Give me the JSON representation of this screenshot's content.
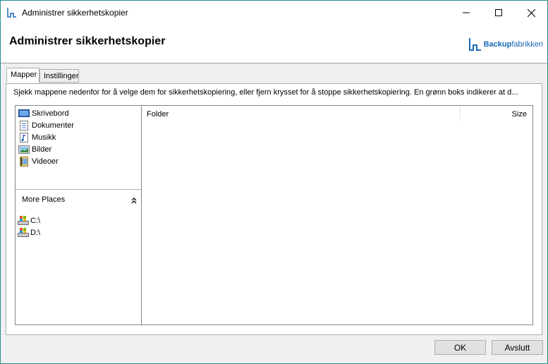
{
  "window": {
    "title": "Administrer sikkerhetskopier",
    "minimize_icon": "minimize-icon",
    "maximize_icon": "maximize-icon",
    "close_icon": "close-icon"
  },
  "header": {
    "heading": "Administrer sikkerhetskopier",
    "logo": {
      "bold": "Backup",
      "rest": "fabrikken",
      "color": "#1769b5"
    }
  },
  "tabs": [
    {
      "label": "Mapper",
      "active": true
    },
    {
      "label": "Instillinger",
      "active": false
    }
  ],
  "instruction": "Sjekk mappene nedenfor for å velge dem for sikkerhetskopiering, eller fjern krysset for å stoppe sikkerhetskopiering. En grønn boks indikerer at d...",
  "folders": [
    {
      "label": "Skrivebord",
      "icon": "desktop-icon"
    },
    {
      "label": "Dokumenter",
      "icon": "documents-icon"
    },
    {
      "label": "Musikk",
      "icon": "music-icon"
    },
    {
      "label": "Bilder",
      "icon": "pictures-icon"
    },
    {
      "label": "Videoer",
      "icon": "videos-icon"
    }
  ],
  "more_places": {
    "label": "More Places",
    "icon": "double-chevron-up-icon"
  },
  "drives": [
    {
      "label": "C:\\",
      "icon": "drive-icon"
    },
    {
      "label": "D:\\",
      "icon": "drive-icon"
    }
  ],
  "columns": {
    "folder": "Folder",
    "size": "Size"
  },
  "buttons": {
    "ok": "OK",
    "exit": "Avslutt"
  }
}
